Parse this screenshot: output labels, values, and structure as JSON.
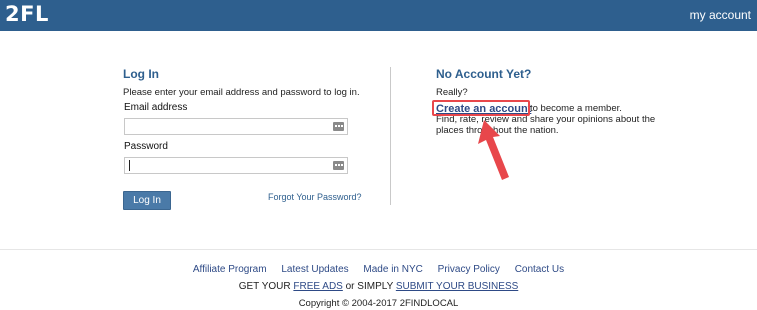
{
  "header": {
    "logo": "2FL",
    "account_link": "my account"
  },
  "login": {
    "title": "Log In",
    "instructions": "Please enter your email address and password to log in.",
    "email_label": "Email address",
    "email_value": "",
    "password_label": "Password",
    "password_value": "",
    "submit_label": "Log In",
    "forgot_link": "Forgot Your Password?"
  },
  "signup": {
    "title": "No Account Yet?",
    "really": "Really?",
    "create_link": "Create an account",
    "become_text": "to become a member.",
    "desc_line1": "Find, rate, review and share your opinions about the",
    "desc_line2": "places throughout the nation."
  },
  "footer": {
    "links": [
      "Affiliate Program",
      "Latest Updates",
      "Made in NYC",
      "Privacy Policy",
      "Contact Us"
    ],
    "promo_prefix": "GET YOUR",
    "promo_link1": "FREE ADS",
    "promo_middle": "or SIMPLY",
    "promo_link2": "SUBMIT YOUR BUSINESS",
    "copyright": "Copyright © 2004-2017 2FINDLOCAL"
  },
  "colors": {
    "header_bg": "#2e5f8e",
    "accent": "#2e5f8e",
    "annotation": "#e8474b"
  },
  "annotation": {
    "highlight": "create-account-link",
    "arrow_icon": "red-arrow-icon"
  }
}
